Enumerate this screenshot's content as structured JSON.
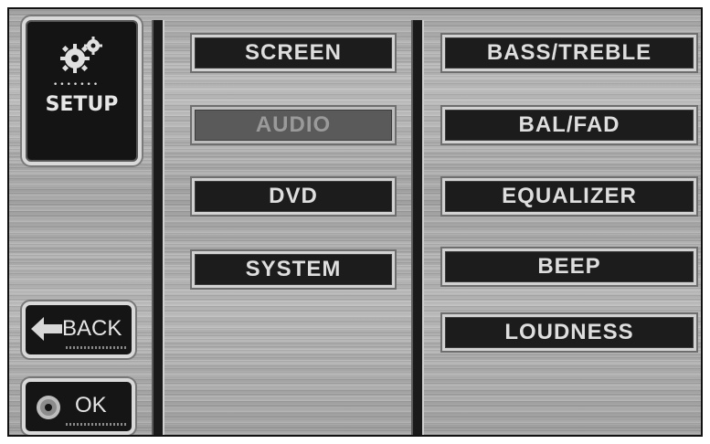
{
  "setup": {
    "icon": "gears-icon",
    "label": "SETUP"
  },
  "main_menu": [
    {
      "label": "SCREEN",
      "active": false
    },
    {
      "label": "AUDIO",
      "active": true
    },
    {
      "label": "DVD",
      "active": false
    },
    {
      "label": "SYSTEM",
      "active": false
    }
  ],
  "audio_menu": [
    {
      "label": "BASS/TREBLE"
    },
    {
      "label": "BAL/FAD"
    },
    {
      "label": "EQUALIZER"
    },
    {
      "label": "BEEP"
    },
    {
      "label": "LOUDNESS"
    }
  ],
  "back_button": {
    "label": "BACK",
    "icon": "left-arrow-icon"
  },
  "ok_button": {
    "label": "OK",
    "icon": "disc-icon"
  },
  "colors": {
    "button_bg": "#1c1c1c",
    "button_text": "#dedede",
    "active_bg": "#5a5a5a",
    "panel_bg": "#b0b0b0"
  }
}
